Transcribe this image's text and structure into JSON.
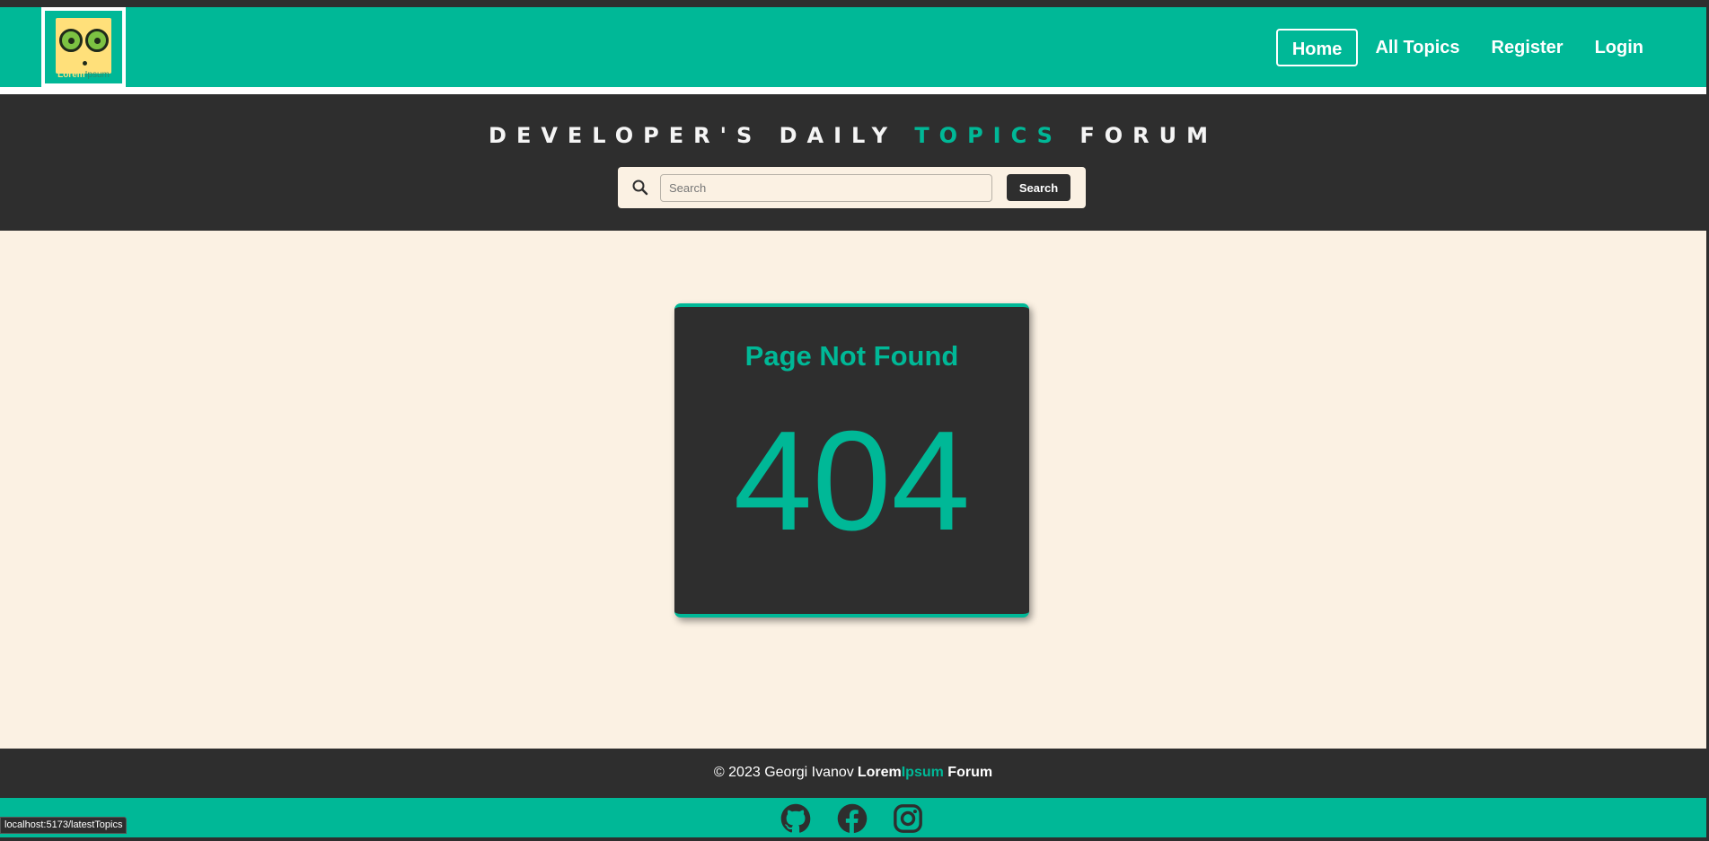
{
  "header": {
    "logo": {
      "text_a": "Lorem",
      "text_b": "Ipsum"
    },
    "nav": [
      {
        "label": "Home",
        "active": true
      },
      {
        "label": "All Topics",
        "active": false
      },
      {
        "label": "Register",
        "active": false
      },
      {
        "label": "Login",
        "active": false
      }
    ]
  },
  "hero": {
    "title_part1": "DEVELOPER'S DAILY",
    "title_accent": "TOPICS",
    "title_part2": "FORUM",
    "search": {
      "placeholder": "Search",
      "value": "",
      "button_label": "Search"
    }
  },
  "error": {
    "title": "Page Not Found",
    "code": "404"
  },
  "footer": {
    "copyright": "© 2023 Georgi Ivanov",
    "brand_a": "Lorem",
    "brand_b": "Ipsum",
    "brand_c": "Forum",
    "social": [
      "github-icon",
      "facebook-icon",
      "instagram-icon"
    ]
  },
  "status_bar": {
    "url": "localhost:5173/latestTopics"
  },
  "colors": {
    "accent": "#00b897",
    "dark": "#2e2e2e",
    "cream": "#fbf1e3"
  }
}
